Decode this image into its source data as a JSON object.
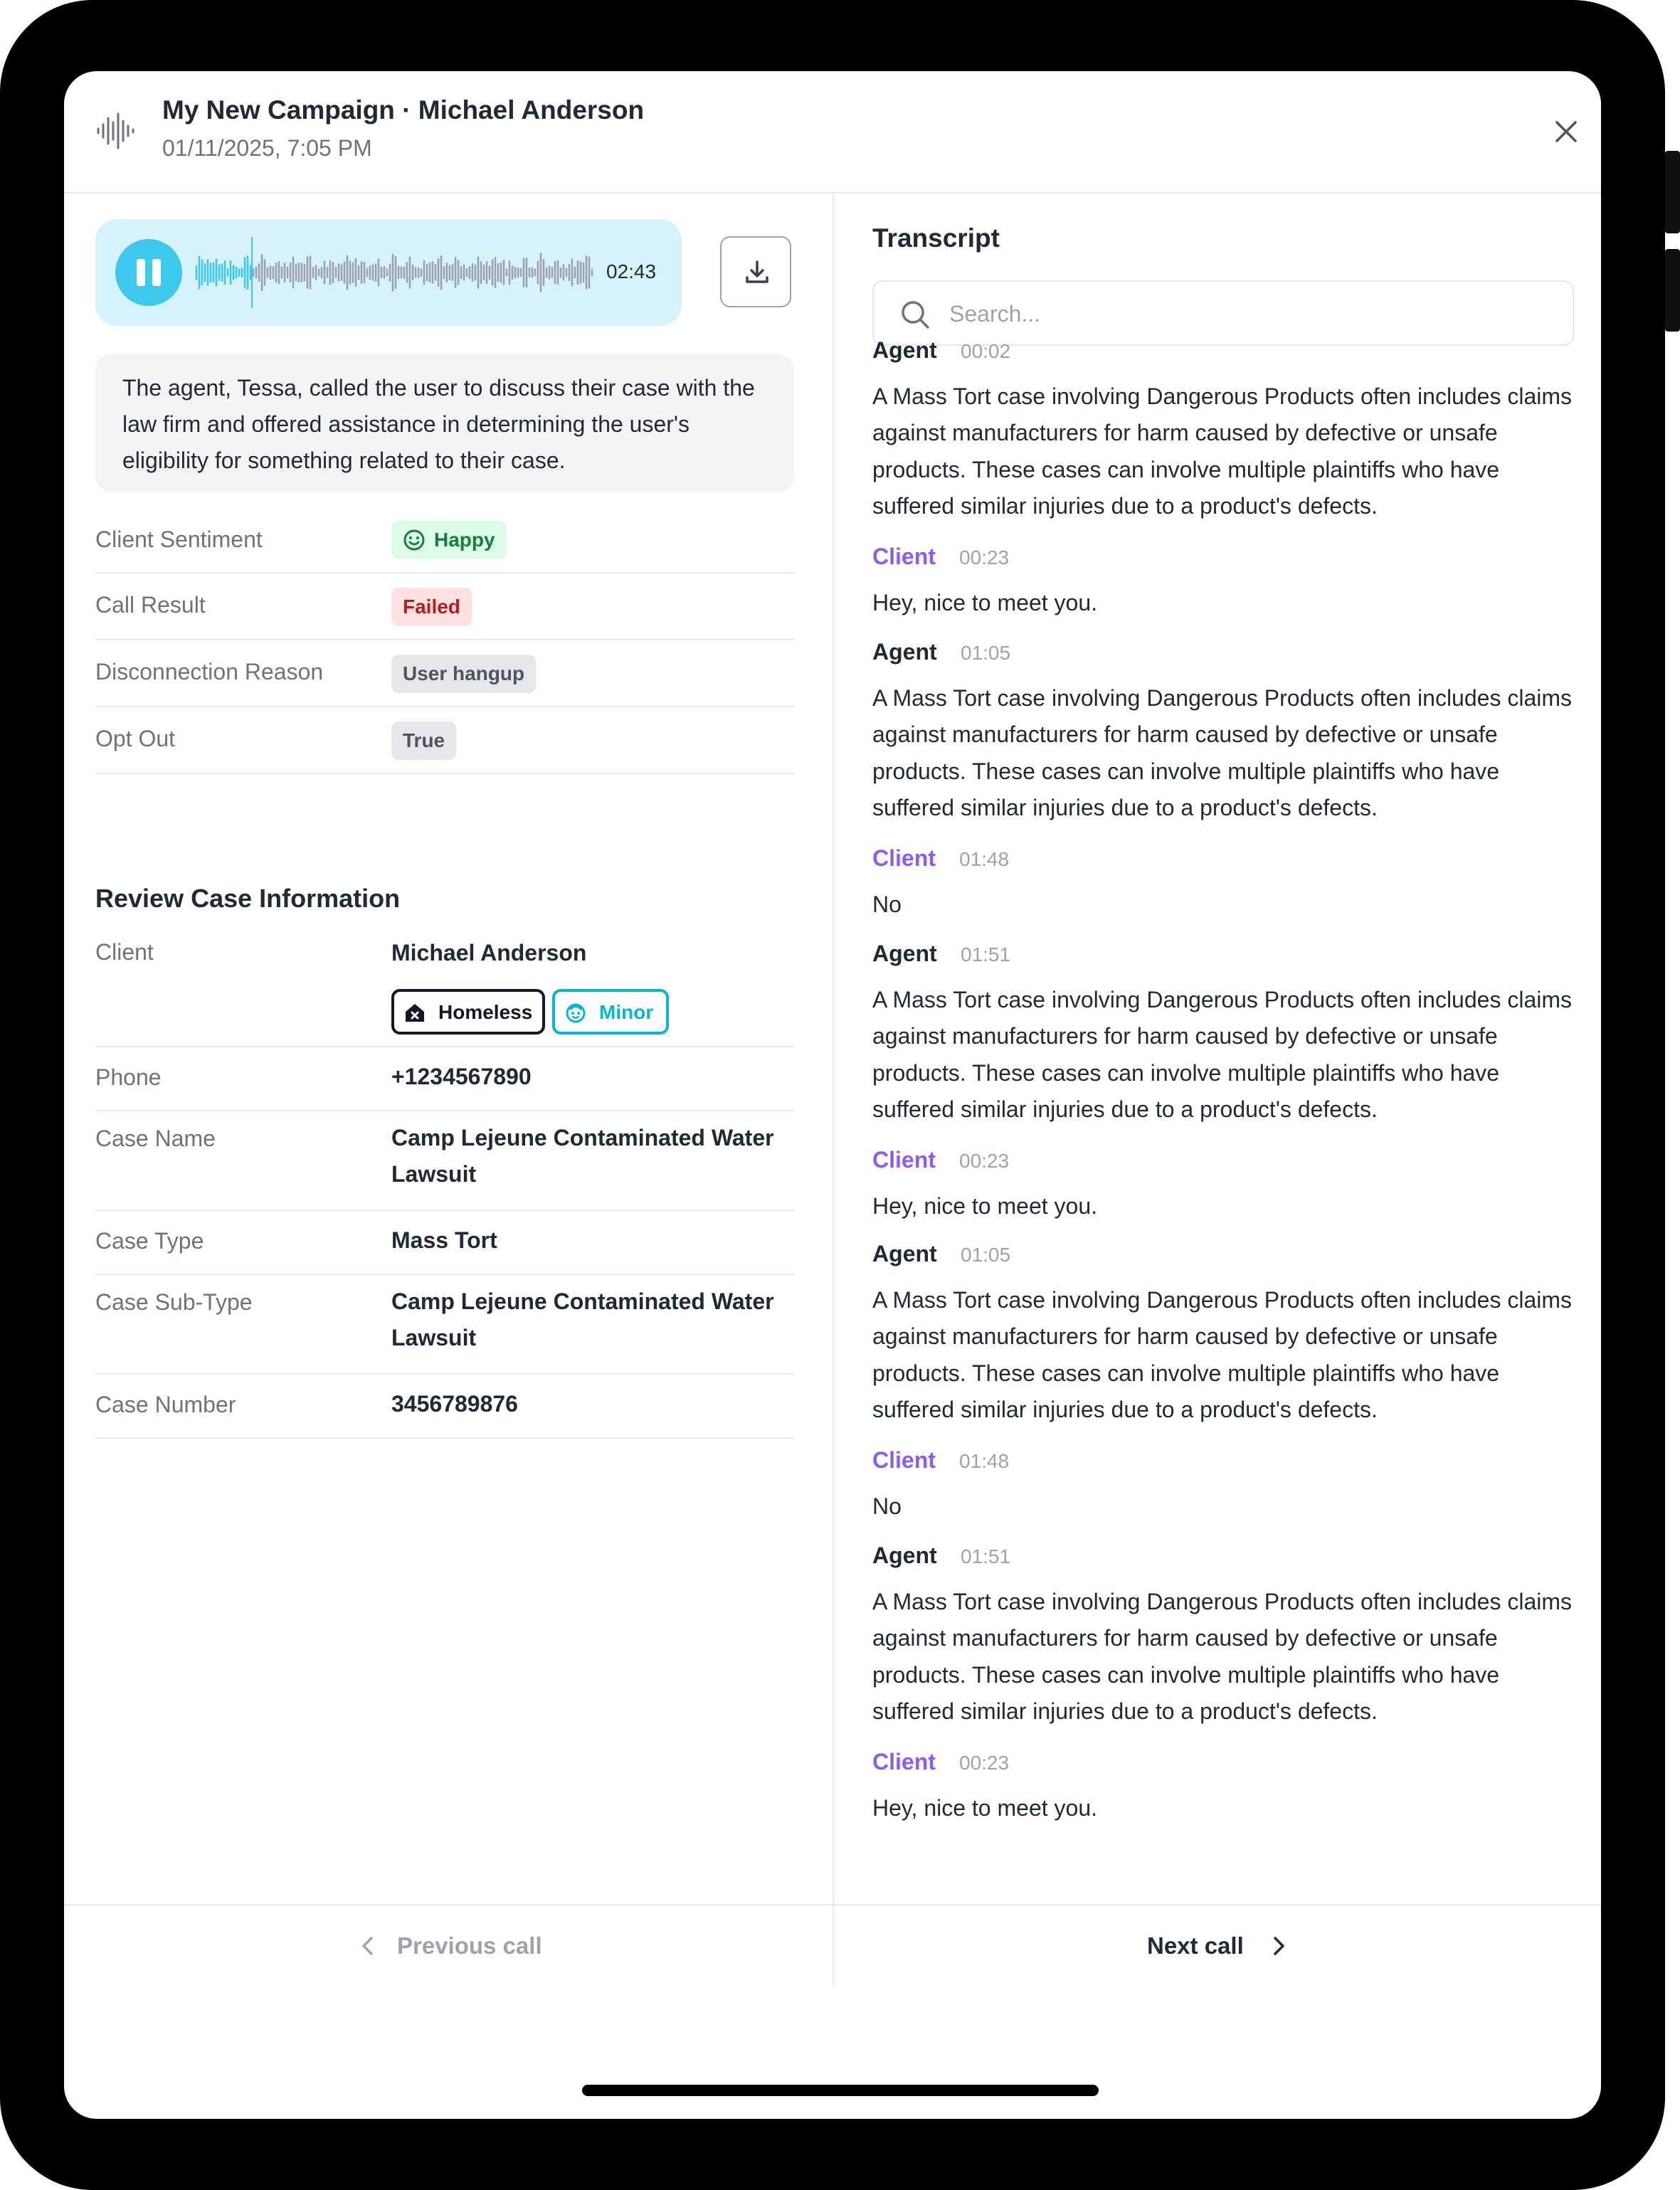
{
  "header": {
    "icon": "waveform-icon",
    "title": "My New Campaign · Michael Anderson",
    "subtitle": "01/11/2025, 7:05 PM",
    "close_icon": "close-icon"
  },
  "player": {
    "state": "playing",
    "control_icon": "pause-icon",
    "duration": "02:43",
    "accent_color": "#3dc8ed",
    "background_color": "#d6f3fb",
    "download_icon": "download-icon"
  },
  "summary": "The agent, Tessa, called the user to discuss their case with the law firm and offered assistance in determining the user's eligibility for something related to their case.",
  "call_details": [
    {
      "label": "Client Sentiment",
      "value": "Happy",
      "style": "green",
      "icon": "smile-icon"
    },
    {
      "label": "Call Result",
      "value": "Failed",
      "style": "red"
    },
    {
      "label": "Disconnection Reason",
      "value": "User hangup",
      "style": "gray"
    },
    {
      "label": "Opt Out",
      "value": "True",
      "style": "gray"
    }
  ],
  "case_section": {
    "title": "Review Case Information",
    "client_label": "Client",
    "client_name": "Michael Anderson",
    "tags": [
      {
        "label": "Homeless",
        "icon": "home-icon",
        "color": "#111827"
      },
      {
        "label": "Minor",
        "icon": "child-face-icon",
        "color": "#06b6d4"
      }
    ],
    "rows": [
      {
        "label": "Phone",
        "value": "+1234567890"
      },
      {
        "label": "Case Name",
        "value": "Camp Lejeune Contaminated Water Lawsuit"
      },
      {
        "label": "Case Type",
        "value": "Mass Tort"
      },
      {
        "label": "Case Sub-Type",
        "value": "Camp Lejeune Contaminated Water Lawsuit"
      },
      {
        "label": "Case Number",
        "value": "3456789876"
      }
    ]
  },
  "transcript": {
    "title": "Transcript",
    "search_placeholder": "Search...",
    "client_color": "#8b5cf6",
    "messages": [
      {
        "speaker": "Agent",
        "time": "00:02",
        "text": "A Mass Tort case involving Dangerous Products often includes claims against manufacturers for harm caused by defective or unsafe products. These cases can involve multiple plaintiffs who have suffered similar injuries due to a product's defects."
      },
      {
        "speaker": "Client",
        "time": "00:23",
        "text": "Hey, nice to meet you."
      },
      {
        "speaker": "Agent",
        "time": "01:05",
        "text": "A Mass Tort case involving Dangerous Products often includes claims against manufacturers for harm caused by defective or unsafe products. These cases can involve multiple plaintiffs who have suffered similar injuries due to a product's defects."
      },
      {
        "speaker": "Client",
        "time": "01:48",
        "text": "No"
      },
      {
        "speaker": "Agent",
        "time": "01:51",
        "text": "A Mass Tort case involving Dangerous Products often includes claims against manufacturers for harm caused by defective or unsafe products. These cases can involve multiple plaintiffs who have suffered similar injuries due to a product's defects."
      },
      {
        "speaker": "Client",
        "time": "00:23",
        "text": "Hey, nice to meet you."
      },
      {
        "speaker": "Agent",
        "time": "01:05",
        "text": "A Mass Tort case involving Dangerous Products often includes claims against manufacturers for harm caused by defective or unsafe products. These cases can involve multiple plaintiffs who have suffered similar injuries due to a product's defects."
      },
      {
        "speaker": "Client",
        "time": "01:48",
        "text": "No"
      },
      {
        "speaker": "Agent",
        "time": "01:51",
        "text": "A Mass Tort case involving Dangerous Products often includes claims against manufacturers for harm caused by defective or unsafe products. These cases can involve multiple plaintiffs who have suffered similar injuries due to a product's defects."
      },
      {
        "speaker": "Client",
        "time": "00:23",
        "text": "Hey, nice to meet you."
      }
    ]
  },
  "footer": {
    "previous_label": "Previous call",
    "previous_icon": "chevron-left-icon",
    "next_label": "Next call",
    "next_icon": "chevron-right-icon"
  }
}
